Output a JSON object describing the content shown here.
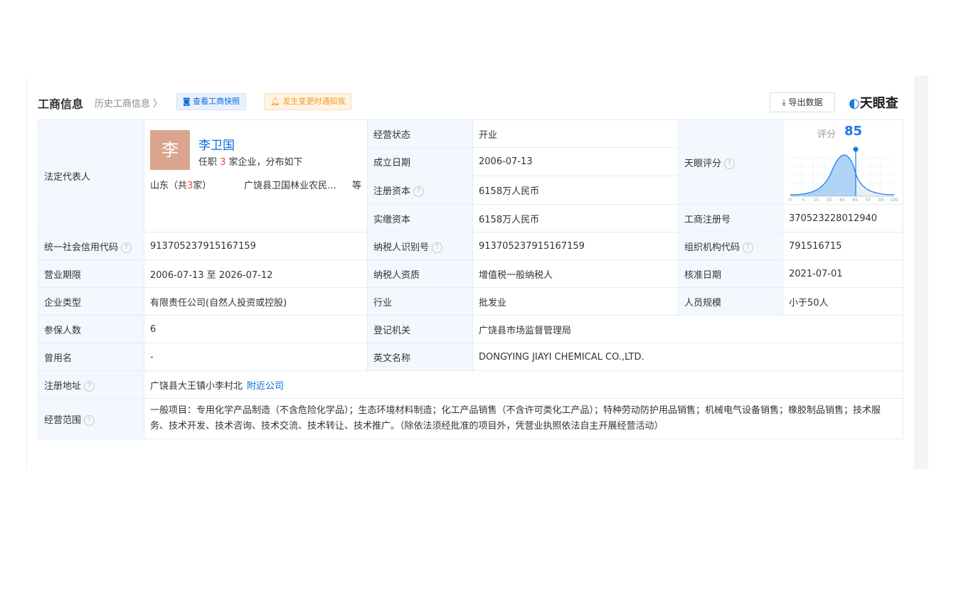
{
  "header": {
    "title": "工商信息",
    "history": "历史工商信息 〉",
    "snapshot_button": "查看工商快照",
    "notify_button": "发生变更时通知我",
    "export_button": "导出数据",
    "logo": "天眼查"
  },
  "legal_rep": {
    "label": "法定代表人",
    "avatar_char": "李",
    "name": "李卫国",
    "sub_prefix": "任职 ",
    "sub_count": "3",
    "sub_suffix": " 家企业，分布如下",
    "region_prefix": "山东（共",
    "region_count": "3",
    "region_suffix": "家）",
    "company": "广饶县卫国林业农民…",
    "more": "等"
  },
  "score": {
    "label": "天眼评分",
    "title": "评分",
    "value": "85",
    "value_fraction": 0.85,
    "axis_ticks": [
      "0",
      "5",
      "15",
      "30",
      "65",
      "85",
      "97",
      "99",
      "100"
    ]
  },
  "fields": {
    "status_label": "经营状态",
    "status": "开业",
    "founded_label": "成立日期",
    "founded": "2006-07-13",
    "reg_capital_label": "注册资本",
    "reg_capital": "6158万人民币",
    "paid_capital_label": "实缴资本",
    "paid_capital": "6158万人民币",
    "reg_no_label": "工商注册号",
    "reg_no": "370523228012940",
    "credit_code_label": "统一社会信用代码",
    "credit_code": "913705237915167159",
    "taxpayer_id_label": "纳税人识别号",
    "taxpayer_id": "913705237915167159",
    "org_code_label": "组织机构代码",
    "org_code": "791516715",
    "term_label": "营业期限",
    "term": "2006-07-13  至 2026-07-12",
    "taxpayer_qual_label": "纳税人资质",
    "taxpayer_qual": "增值税一般纳税人",
    "approval_label": "核准日期",
    "approval": "2021-07-01",
    "type_label": "企业类型",
    "type": "有限责任公司(自然人投资或控股)",
    "industry_label": "行业",
    "industry": "批发业",
    "staff_label": "人员规模",
    "staff": "小于50人",
    "insured_label": "参保人数",
    "insured": "6",
    "authority_label": "登记机关",
    "authority": "广饶县市场监督管理局",
    "former_label": "曾用名",
    "former": "-",
    "english_label": "英文名称",
    "english": "DONGYING JIAYI CHEMICAL CO.,LTD.",
    "address_label": "注册地址",
    "address": "广饶县大王镇小李村北",
    "nearby": "附近公司",
    "scope_label": "经营范围",
    "scope": "一般项目：专用化学产品制造（不含危险化学品）；生态环境材料制造；化工产品销售（不含许可类化工产品）；特种劳动防护用品销售；机械电气设备销售；橡胶制品销售；技术服务、技术开发、技术咨询、技术交流、技术转让、技术推广。（除依法须经批准的项目外，凭营业执照依法自主开展经营活动）"
  },
  "colors": {
    "accent": "#1976e8",
    "label_bg": "#f2f8fe",
    "highlight": "#f0483e"
  }
}
